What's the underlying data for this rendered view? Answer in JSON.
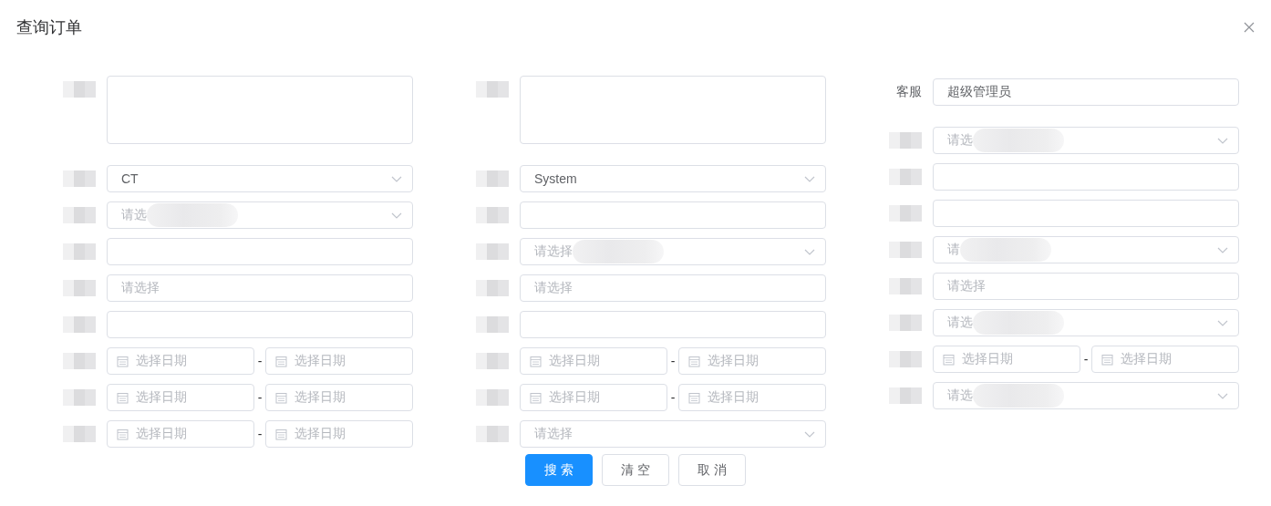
{
  "dialog": {
    "title": "查询订单"
  },
  "columns": [
    {
      "rows": [
        {
          "kind": "textarea",
          "label_pixelated": true
        },
        {
          "kind": "select",
          "label_pixelated": true,
          "value": "CT"
        },
        {
          "kind": "select",
          "label_pixelated": true,
          "placeholder": "请选",
          "smudged": true
        },
        {
          "kind": "input",
          "label_pixelated": true
        },
        {
          "kind": "input",
          "label_pixelated": true,
          "placeholder": "请选择"
        },
        {
          "kind": "input",
          "label_pixelated": true
        },
        {
          "kind": "daterange",
          "label_pixelated": true,
          "start_placeholder": "选择日期",
          "separator": "-",
          "end_placeholder": "选择日期"
        },
        {
          "kind": "daterange",
          "label_pixelated": true,
          "start_placeholder": "选择日期",
          "separator": "-",
          "end_placeholder": "选择日期"
        },
        {
          "kind": "daterange",
          "label_pixelated": true,
          "start_placeholder": "选择日期",
          "separator": "-",
          "end_placeholder": "选择日期"
        }
      ]
    },
    {
      "rows": [
        {
          "kind": "textarea",
          "label_pixelated": true
        },
        {
          "kind": "select",
          "label_pixelated": true,
          "value": "System"
        },
        {
          "kind": "input",
          "label_pixelated": true
        },
        {
          "kind": "select",
          "label_pixelated": true,
          "placeholder": "请选择",
          "smudged": true
        },
        {
          "kind": "input",
          "label_pixelated": true,
          "placeholder": "请选择"
        },
        {
          "kind": "input",
          "label_pixelated": true
        },
        {
          "kind": "daterange",
          "label_pixelated": true,
          "start_placeholder": "选择日期",
          "separator": "-",
          "end_placeholder": "选择日期"
        },
        {
          "kind": "daterange",
          "label_pixelated": true,
          "start_placeholder": "选择日期",
          "separator": "-",
          "end_placeholder": "选择日期"
        },
        {
          "kind": "select",
          "label_pixelated": true,
          "placeholder": "请选择"
        }
      ]
    },
    {
      "rows": [
        {
          "kind": "input",
          "label": "客服",
          "value": "超级管理员"
        },
        {
          "kind": "select",
          "label_pixelated": true,
          "placeholder": "请选",
          "smudged": true
        },
        {
          "kind": "input",
          "label_pixelated": true
        },
        {
          "kind": "input",
          "label_pixelated": true
        },
        {
          "kind": "select",
          "label_pixelated": true,
          "placeholder": "请",
          "smudged": true
        },
        {
          "kind": "input",
          "label_pixelated": true,
          "placeholder": "请选择"
        },
        {
          "kind": "select",
          "label_pixelated": true,
          "placeholder": "请选",
          "smudged": true
        },
        {
          "kind": "daterange",
          "label_pixelated": true,
          "start_placeholder": "选择日期",
          "separator": "-",
          "end_placeholder": "选择日期"
        },
        {
          "kind": "select",
          "label_pixelated": true,
          "placeholder": "请选",
          "smudged": true
        }
      ]
    }
  ],
  "buttons": [
    {
      "label": "搜索",
      "primary": true
    },
    {
      "label": "清空",
      "primary": false
    },
    {
      "label": "取消",
      "primary": false
    }
  ]
}
